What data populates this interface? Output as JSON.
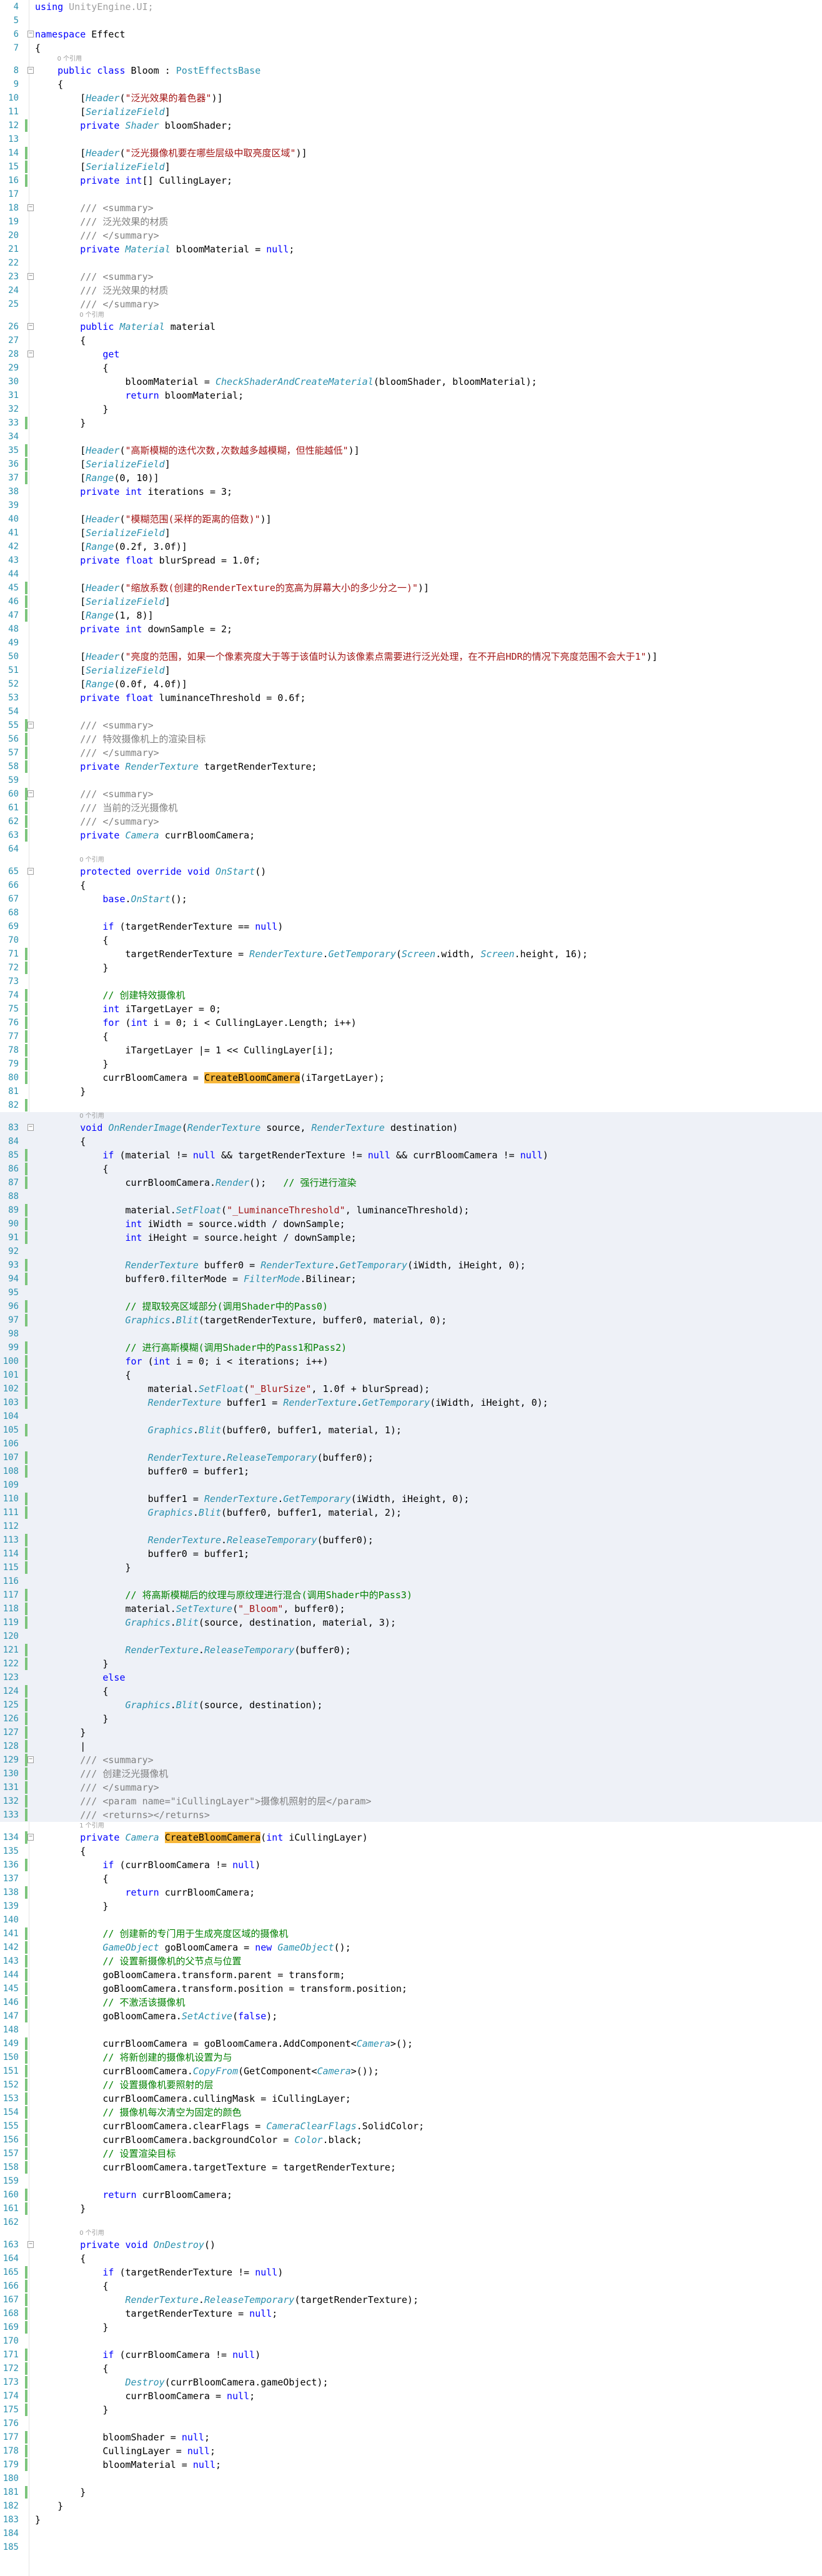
{
  "editor": {
    "language": "csharp",
    "theme": "light",
    "colors": {
      "keyword": "#0000ff",
      "type": "#2b91af",
      "string": "#a31515",
      "comment": "#008000",
      "doc_comment": "#808080",
      "line_number": "#2b91af",
      "change_marker": "#7cc47c",
      "highlight_match": "#f7b73a",
      "selection_line": "#eef1f7"
    },
    "reference_lens": {
      "refs_0": "0 个引用",
      "refs_1": "1 个引用"
    },
    "lines": [
      {
        "n": "4",
        "t": "using UnityEngine.UI;"
      },
      {
        "n": "5",
        "t": ""
      },
      {
        "n": "6",
        "t": "namespace Effect"
      },
      {
        "n": "7",
        "t": "{"
      },
      {
        "n": "8",
        "t": "    public class Bloom : PostEffectsBase"
      },
      {
        "n": "9",
        "t": "    {"
      },
      {
        "n": "10",
        "t": "        [Header(\"泛光效果的着色器\")]"
      },
      {
        "n": "11",
        "t": "        [SerializeField]"
      },
      {
        "n": "12",
        "t": "        private Shader bloomShader;"
      },
      {
        "n": "13",
        "t": ""
      },
      {
        "n": "14",
        "t": "        [Header(\"泛光摄像机要在哪些层级中取亮度区域\")]"
      },
      {
        "n": "15",
        "t": "        [SerializeField]"
      },
      {
        "n": "16",
        "t": "        private int[] CullingLayer;"
      },
      {
        "n": "17",
        "t": ""
      },
      {
        "n": "18",
        "t": "        /// <summary>"
      },
      {
        "n": "19",
        "t": "        /// 泛光效果的材质"
      },
      {
        "n": "20",
        "t": "        /// </summary>"
      },
      {
        "n": "21",
        "t": "        private Material bloomMaterial = null;"
      },
      {
        "n": "22",
        "t": ""
      },
      {
        "n": "23",
        "t": "        /// <summary>"
      },
      {
        "n": "24",
        "t": "        /// 泛光效果的材质"
      },
      {
        "n": "25",
        "t": "        /// </summary>"
      },
      {
        "n": "26",
        "t": "        public Material material"
      },
      {
        "n": "27",
        "t": "        {"
      },
      {
        "n": "28",
        "t": "            get"
      },
      {
        "n": "29",
        "t": "            {"
      },
      {
        "n": "30",
        "t": "                bloomMaterial = CheckShaderAndCreateMaterial(bloomShader, bloomMaterial);"
      },
      {
        "n": "31",
        "t": "                return bloomMaterial;"
      },
      {
        "n": "32",
        "t": "            }"
      },
      {
        "n": "33",
        "t": "        }"
      },
      {
        "n": "34",
        "t": ""
      },
      {
        "n": "35",
        "t": "        [Header(\"高斯模糊的迭代次数,次数越多越模糊，但性能越低\")]"
      },
      {
        "n": "36",
        "t": "        [SerializeField]"
      },
      {
        "n": "37",
        "t": "        [Range(0, 10)]"
      },
      {
        "n": "38",
        "t": "        private int iterations = 3;"
      },
      {
        "n": "39",
        "t": ""
      },
      {
        "n": "40",
        "t": "        [Header(\"模糊范围(采样的距离的倍数)\")]"
      },
      {
        "n": "41",
        "t": "        [SerializeField]"
      },
      {
        "n": "42",
        "t": "        [Range(0.2f, 3.0f)]"
      },
      {
        "n": "43",
        "t": "        private float blurSpread = 1.0f;"
      },
      {
        "n": "44",
        "t": ""
      },
      {
        "n": "45",
        "t": "        [Header(\"缩放系数(创建的RenderTexture的宽高为屏幕大小的多少分之一)\")]"
      },
      {
        "n": "46",
        "t": "        [SerializeField]"
      },
      {
        "n": "47",
        "t": "        [Range(1, 8)]"
      },
      {
        "n": "48",
        "t": "        private int downSample = 2;"
      },
      {
        "n": "49",
        "t": ""
      },
      {
        "n": "50",
        "t": "        [Header(\"亮度的范围，如果一个像素亮度大于等于该值时认为该像素点需要进行泛光处理，在不开启HDR的情况下亮度范围不会大于1\")]"
      },
      {
        "n": "51",
        "t": "        [SerializeField]"
      },
      {
        "n": "52",
        "t": "        [Range(0.0f, 4.0f)]"
      },
      {
        "n": "53",
        "t": "        private float luminanceThreshold = 0.6f;"
      },
      {
        "n": "54",
        "t": ""
      },
      {
        "n": "55",
        "t": "        /// <summary>"
      },
      {
        "n": "56",
        "t": "        /// 特效摄像机上的渲染目标"
      },
      {
        "n": "57",
        "t": "        /// </summary>"
      },
      {
        "n": "58",
        "t": "        private RenderTexture targetRenderTexture;"
      },
      {
        "n": "59",
        "t": ""
      },
      {
        "n": "60",
        "t": "        /// <summary>"
      },
      {
        "n": "61",
        "t": "        /// 当前的泛光摄像机"
      },
      {
        "n": "62",
        "t": "        /// </summary>"
      },
      {
        "n": "63",
        "t": "        private Camera currBloomCamera;"
      },
      {
        "n": "64",
        "t": ""
      },
      {
        "n": "65",
        "t": "        protected override void OnStart()"
      },
      {
        "n": "66",
        "t": "        {"
      },
      {
        "n": "67",
        "t": "            base.OnStart();"
      },
      {
        "n": "68",
        "t": ""
      },
      {
        "n": "69",
        "t": "            if (targetRenderTexture == null)"
      },
      {
        "n": "70",
        "t": "            {"
      },
      {
        "n": "71",
        "t": "                targetRenderTexture = RenderTexture.GetTemporary(Screen.width, Screen.height, 16);"
      },
      {
        "n": "72",
        "t": "            }"
      },
      {
        "n": "73",
        "t": ""
      },
      {
        "n": "74",
        "t": "            // 创建特效摄像机"
      },
      {
        "n": "75",
        "t": "            int iTargetLayer = 0;"
      },
      {
        "n": "76",
        "t": "            for (int i = 0; i < CullingLayer.Length; i++)"
      },
      {
        "n": "77",
        "t": "            {"
      },
      {
        "n": "78",
        "t": "                iTargetLayer |= 1 << CullingLayer[i];"
      },
      {
        "n": "79",
        "t": "            }"
      },
      {
        "n": "80",
        "t": "            currBloomCamera = CreateBloomCamera(iTargetLayer);"
      },
      {
        "n": "81",
        "t": "        }"
      },
      {
        "n": "82",
        "t": ""
      },
      {
        "n": "83",
        "t": "        void OnRenderImage(RenderTexture source, RenderTexture destination)"
      },
      {
        "n": "84",
        "t": "        {"
      },
      {
        "n": "85",
        "t": "            if (material != null && targetRenderTexture != null && currBloomCamera != null)"
      },
      {
        "n": "86",
        "t": "            {"
      },
      {
        "n": "87",
        "t": "                currBloomCamera.Render();   // 强行进行渲染"
      },
      {
        "n": "88",
        "t": ""
      },
      {
        "n": "89",
        "t": "                material.SetFloat(\"_LuminanceThreshold\", luminanceThreshold);"
      },
      {
        "n": "90",
        "t": "                int iWidth = source.width / downSample;"
      },
      {
        "n": "91",
        "t": "                int iHeight = source.height / downSample;"
      },
      {
        "n": "92",
        "t": ""
      },
      {
        "n": "93",
        "t": "                RenderTexture buffer0 = RenderTexture.GetTemporary(iWidth, iHeight, 0);"
      },
      {
        "n": "94",
        "t": "                buffer0.filterMode = FilterMode.Bilinear;"
      },
      {
        "n": "95",
        "t": ""
      },
      {
        "n": "96",
        "t": "                // 提取较亮区域部分(调用Shader中的Pass0)"
      },
      {
        "n": "97",
        "t": "                Graphics.Blit(targetRenderTexture, buffer0, material, 0);"
      },
      {
        "n": "98",
        "t": ""
      },
      {
        "n": "99",
        "t": "                // 进行高斯模糊(调用Shader中的Pass1和Pass2)"
      },
      {
        "n": "100",
        "t": "                for (int i = 0; i < iterations; i++)"
      },
      {
        "n": "101",
        "t": "                {"
      },
      {
        "n": "102",
        "t": "                    material.SetFloat(\"_BlurSize\", 1.0f + blurSpread);"
      },
      {
        "n": "103",
        "t": "                    RenderTexture buffer1 = RenderTexture.GetTemporary(iWidth, iHeight, 0);"
      },
      {
        "n": "104",
        "t": ""
      },
      {
        "n": "105",
        "t": "                    Graphics.Blit(buffer0, buffer1, material, 1);"
      },
      {
        "n": "106",
        "t": ""
      },
      {
        "n": "107",
        "t": "                    RenderTexture.ReleaseTemporary(buffer0);"
      },
      {
        "n": "108",
        "t": "                    buffer0 = buffer1;"
      },
      {
        "n": "109",
        "t": ""
      },
      {
        "n": "110",
        "t": "                    buffer1 = RenderTexture.GetTemporary(iWidth, iHeight, 0);"
      },
      {
        "n": "111",
        "t": "                    Graphics.Blit(buffer0, buffer1, material, 2);"
      },
      {
        "n": "112",
        "t": ""
      },
      {
        "n": "113",
        "t": "                    RenderTexture.ReleaseTemporary(buffer0);"
      },
      {
        "n": "114",
        "t": "                    buffer0 = buffer1;"
      },
      {
        "n": "115",
        "t": "                }"
      },
      {
        "n": "116",
        "t": ""
      },
      {
        "n": "117",
        "t": "                // 将高斯模糊后的纹理与原纹理进行混合(调用Shader中的Pass3)"
      },
      {
        "n": "118",
        "t": "                material.SetTexture(\"_Bloom\", buffer0);"
      },
      {
        "n": "119",
        "t": "                Graphics.Blit(source, destination, material, 3);"
      },
      {
        "n": "120",
        "t": ""
      },
      {
        "n": "121",
        "t": "                RenderTexture.ReleaseTemporary(buffer0);"
      },
      {
        "n": "122",
        "t": "            }"
      },
      {
        "n": "123",
        "t": "            else"
      },
      {
        "n": "124",
        "t": "            {"
      },
      {
        "n": "125",
        "t": "                Graphics.Blit(source, destination);"
      },
      {
        "n": "126",
        "t": "            }"
      },
      {
        "n": "127",
        "t": "        }"
      },
      {
        "n": "128",
        "t": "        |"
      },
      {
        "n": "129",
        "t": "        /// <summary>"
      },
      {
        "n": "130",
        "t": "        /// 创建泛光摄像机"
      },
      {
        "n": "131",
        "t": "        /// </summary>"
      },
      {
        "n": "132",
        "t": "        /// <param name=\"iCullingLayer\">摄像机照射的层</param>"
      },
      {
        "n": "133",
        "t": "        /// <returns></returns>"
      },
      {
        "n": "134",
        "t": "        private Camera CreateBloomCamera(int iCullingLayer)"
      },
      {
        "n": "135",
        "t": "        {"
      },
      {
        "n": "136",
        "t": "            if (currBloomCamera != null)"
      },
      {
        "n": "137",
        "t": "            {"
      },
      {
        "n": "138",
        "t": "                return currBloomCamera;"
      },
      {
        "n": "139",
        "t": "            }"
      },
      {
        "n": "140",
        "t": ""
      },
      {
        "n": "141",
        "t": "            // 创建新的专门用于生成亮度区域的摄像机"
      },
      {
        "n": "142",
        "t": "            GameObject goBloomCamera = new GameObject();"
      },
      {
        "n": "143",
        "t": "            // 设置新摄像机的父节点与位置"
      },
      {
        "n": "144",
        "t": "            goBloomCamera.transform.parent = transform;"
      },
      {
        "n": "145",
        "t": "            goBloomCamera.transform.position = transform.position;"
      },
      {
        "n": "146",
        "t": "            // 不激活该摄像机"
      },
      {
        "n": "147",
        "t": "            goBloomCamera.SetActive(false);"
      },
      {
        "n": "148",
        "t": ""
      },
      {
        "n": "149",
        "t": "            currBloomCamera = goBloomCamera.AddComponent<Camera>();"
      },
      {
        "n": "150",
        "t": "            // 将新创建的摄像机设置为与"
      },
      {
        "n": "151",
        "t": "            currBloomCamera.CopyFrom(GetComponent<Camera>());"
      },
      {
        "n": "152",
        "t": "            // 设置摄像机要照射的层"
      },
      {
        "n": "153",
        "t": "            currBloomCamera.cullingMask = iCullingLayer;"
      },
      {
        "n": "154",
        "t": "            // 摄像机每次清空为固定的颜色"
      },
      {
        "n": "155",
        "t": "            currBloomCamera.clearFlags = CameraClearFlags.SolidColor;"
      },
      {
        "n": "156",
        "t": "            currBloomCamera.backgroundColor = Color.black;"
      },
      {
        "n": "157",
        "t": "            // 设置渲染目标"
      },
      {
        "n": "158",
        "t": "            currBloomCamera.targetTexture = targetRenderTexture;"
      },
      {
        "n": "159",
        "t": ""
      },
      {
        "n": "160",
        "t": "            return currBloomCamera;"
      },
      {
        "n": "161",
        "t": "        }"
      },
      {
        "n": "162",
        "t": ""
      },
      {
        "n": "163",
        "t": "        private void OnDestroy()"
      },
      {
        "n": "164",
        "t": "        {"
      },
      {
        "n": "165",
        "t": "            if (targetRenderTexture != null)"
      },
      {
        "n": "166",
        "t": "            {"
      },
      {
        "n": "167",
        "t": "                RenderTexture.ReleaseTemporary(targetRenderTexture);"
      },
      {
        "n": "168",
        "t": "                targetRenderTexture = null;"
      },
      {
        "n": "169",
        "t": "            }"
      },
      {
        "n": "170",
        "t": ""
      },
      {
        "n": "171",
        "t": "            if (currBloomCamera != null)"
      },
      {
        "n": "172",
        "t": "            {"
      },
      {
        "n": "173",
        "t": "                Destroy(currBloomCamera.gameObject);"
      },
      {
        "n": "174",
        "t": "                currBloomCamera = null;"
      },
      {
        "n": "175",
        "t": "            }"
      },
      {
        "n": "176",
        "t": ""
      },
      {
        "n": "177",
        "t": "            bloomShader = null;"
      },
      {
        "n": "178",
        "t": "            CullingLayer = null;"
      },
      {
        "n": "179",
        "t": "            bloomMaterial = null;"
      },
      {
        "n": "180",
        "t": ""
      },
      {
        "n": "181",
        "t": "        }"
      },
      {
        "n": "182",
        "t": "    }"
      },
      {
        "n": "183",
        "t": "}"
      },
      {
        "n": "184",
        "t": ""
      },
      {
        "n": "185",
        "t": ""
      }
    ]
  }
}
